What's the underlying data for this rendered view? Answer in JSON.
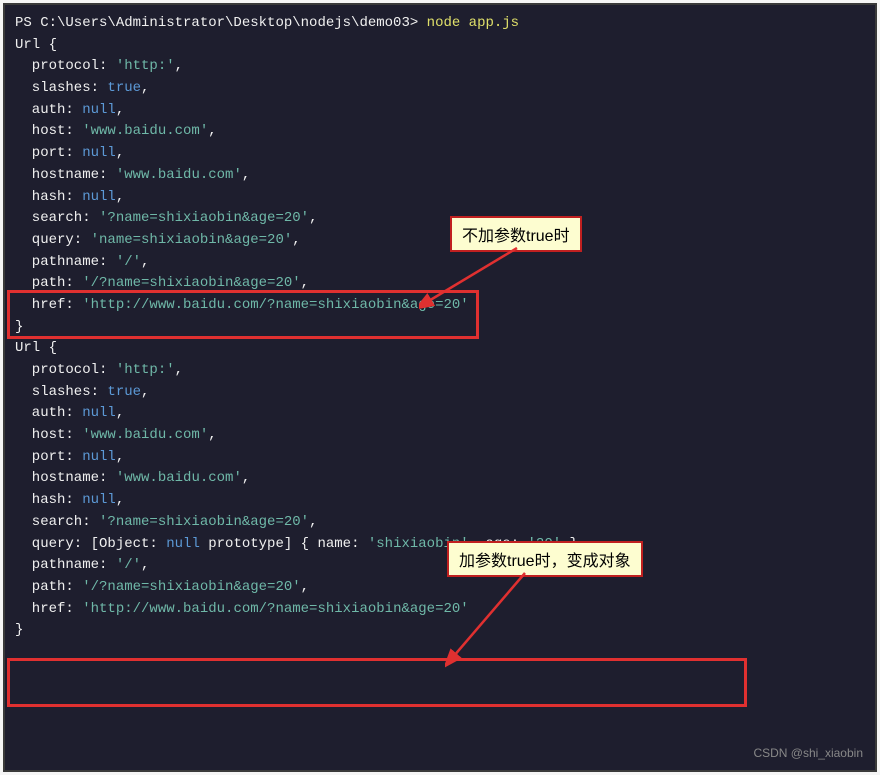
{
  "prompt": "PS C:\\Users\\Administrator\\Desktop\\nodejs\\demo03> ",
  "command": "node app.js",
  "annotations": {
    "a1": "不加参数true时",
    "a2": "加参数true时，变成对象"
  },
  "code": {
    "l1": "Url {",
    "l2_pre": "  protocol: ",
    "l2_str": "'http:'",
    "l3_pre": "  slashes: ",
    "l3_kw": "true",
    "l4_pre": "  auth: ",
    "l4_kw": "null",
    "l5_pre": "  host: ",
    "l5_str": "'www.baidu.com'",
    "l6_pre": "  port: ",
    "l6_kw": "null",
    "l7_pre": "  hostname: ",
    "l7_str": "'www.baidu.com'",
    "l8_pre": "  hash: ",
    "l8_kw": "null",
    "l9_pre": "  search: ",
    "l9_str": "'?name=shixiaobin&age=20'",
    "l10_pre": "  query: ",
    "l10_str": "'name=shixiaobin&age=20'",
    "l11_pre": "  pathname: ",
    "l11_str": "'/'",
    "l12_pre": "  path: ",
    "l12_str": "'/?name=shixiaobin&age=20'",
    "l13_pre": "  href: ",
    "l13_str": "'http://www.baidu.com/?name=shixiaobin&age=20'",
    "l14": "}",
    "l15": "Url {",
    "l16_pre": "  protocol: ",
    "l16_str": "'http:'",
    "l17_pre": "  slashes: ",
    "l17_kw": "true",
    "l18_pre": "  auth: ",
    "l18_kw": "null",
    "l19_pre": "  host: ",
    "l19_str": "'www.baidu.com'",
    "l20_pre": "  port: ",
    "l20_kw": "null",
    "l21_pre": "  hostname: ",
    "l21_str": "'www.baidu.com'",
    "l22_pre": "  hash: ",
    "l22_kw": "null",
    "l23_pre": "  search: ",
    "l23_str": "'?name=shixiaobin&age=20'",
    "l24_pre": "  query: [Object: ",
    "l24_kw": "null",
    "l24_mid": " prototype] { name: ",
    "l24_s1": "'shixiaobin'",
    "l24_mid2": ", age: ",
    "l24_s2": "'20'",
    "l24_end": " },",
    "l25_pre": "  pathname: ",
    "l25_str": "'/'",
    "l26_pre": "  path: ",
    "l26_str": "'/?name=shixiaobin&age=20'",
    "l27_pre": "  href: ",
    "l27_str": "'http://www.baidu.com/?name=shixiaobin&age=20'",
    "l28": "}",
    "comma": ","
  },
  "watermark": "CSDN @shi_xiaobin"
}
